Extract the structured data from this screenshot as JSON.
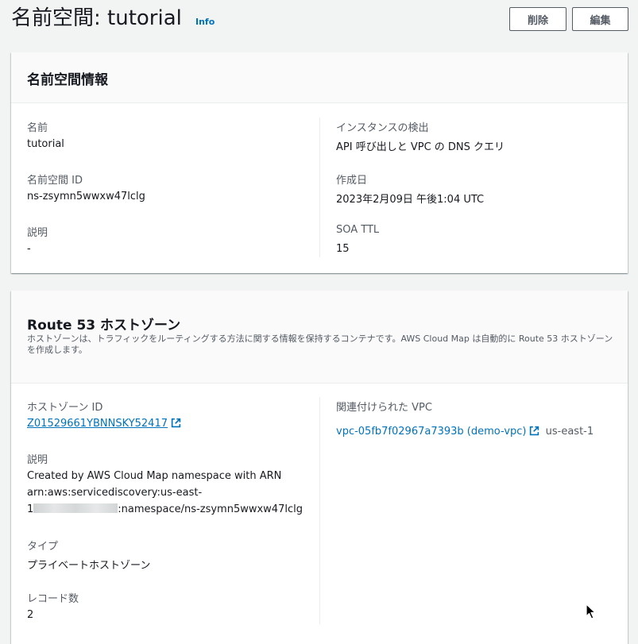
{
  "header": {
    "title": "名前空間: tutorial",
    "info": "Info",
    "delete_label": "削除",
    "edit_label": "編集"
  },
  "namespace_info": {
    "title": "名前空間情報",
    "name_label": "名前",
    "name_value": "tutorial",
    "id_label": "名前空間 ID",
    "id_value": "ns-zsymn5wwxw47lclg",
    "desc_label": "説明",
    "desc_value": "-",
    "discovery_label": "インスタンスの検出",
    "discovery_value": "API 呼び出しと VPC の DNS クエリ",
    "created_label": "作成日",
    "created_value": "2023年2月09日 午後1:04 UTC",
    "soa_label": "SOA TTL",
    "soa_value": "15"
  },
  "hosted_zone": {
    "title": "Route 53 ホストゾーン",
    "description": "ホストゾーンは、トラフィックをルーティングする方法に関する情報を保持するコンテナです。AWS Cloud Map は自動的に Route 53 ホストゾーンを作成します。",
    "zone_id_label": "ホストゾーン ID",
    "zone_id_value": "Z01529661YBNNSKY52417",
    "desc_label": "説明",
    "desc_line1": "Created by AWS Cloud Map namespace with ARN",
    "desc_line2": "arn:aws:servicediscovery:us-east-",
    "desc_line3_prefix": "1",
    "desc_line3_suffix": ":namespace/ns-zsymn5wwxw47lclg",
    "type_label": "タイプ",
    "type_value": "プライベートホストゾーン",
    "records_label": "レコード数",
    "records_value": "2",
    "vpc_label": "関連付けられた VPC",
    "vpc_link": "vpc-05fb7f02967a7393b (demo-vpc)",
    "vpc_region": "us-east-1"
  },
  "icons": {
    "external": "external-link-icon",
    "cursor": "mouse-cursor-icon"
  },
  "colors": {
    "link": "#0073bb",
    "text": "#16191f",
    "label": "#545b64",
    "background": "#f2f3f3"
  }
}
